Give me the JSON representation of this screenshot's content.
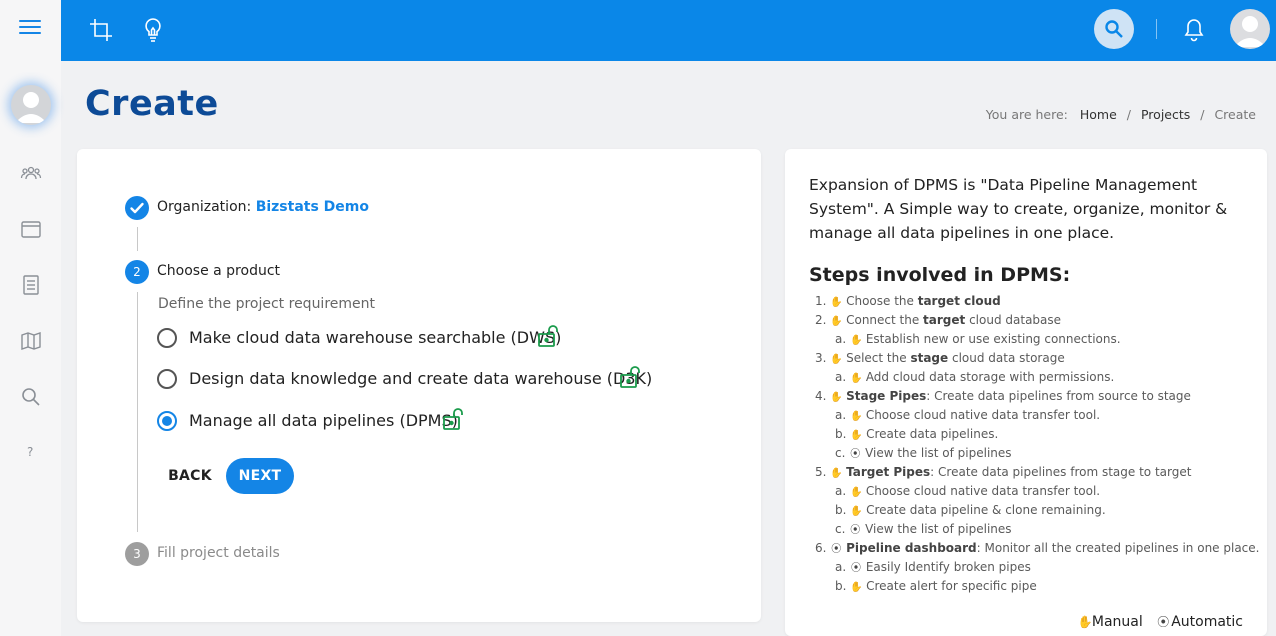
{
  "rail": {
    "items": [
      "groups-icon",
      "window-icon",
      "document-icon",
      "map-icon",
      "search-icon"
    ],
    "help_label": "?"
  },
  "header": {
    "title": "Create",
    "breadcrumb": {
      "prefix": "You are here:",
      "items": [
        "Home",
        "Projects"
      ],
      "current": "Create"
    }
  },
  "stepper": {
    "step1": {
      "label": "Organization:",
      "value": "Bizstats Demo"
    },
    "step2": {
      "number": "2",
      "label": "Choose a product",
      "sublabel": "Define the project requirement",
      "options": [
        {
          "label": "Make cloud data warehouse searchable (DWS)",
          "selected": false
        },
        {
          "label": "Design data knowledge and create data warehouse (D3K)",
          "selected": false
        },
        {
          "label": "Manage all data pipelines (DPMS)",
          "selected": true
        }
      ],
      "back_label": "BACK",
      "next_label": "NEXT"
    },
    "step3": {
      "number": "3",
      "label": "Fill project details"
    }
  },
  "info": {
    "intro": "Expansion of DPMS is \"Data Pipeline Management System\". A Simple way to create, organize, monitor & manage all data pipelines in one place.",
    "heading": "Steps involved in DPMS:",
    "steps": [
      {
        "marker": "1.",
        "icon": "manual",
        "parts": [
          [
            "Choose the ",
            false
          ],
          [
            "target cloud",
            true
          ]
        ],
        "sub": []
      },
      {
        "marker": "2.",
        "icon": "manual",
        "parts": [
          [
            "Connect the ",
            false
          ],
          [
            "target",
            true
          ],
          [
            " cloud database",
            false
          ]
        ],
        "sub": [
          {
            "marker": "a.",
            "icon": "manual",
            "text": "Establish new or use existing connections."
          }
        ]
      },
      {
        "marker": "3.",
        "icon": "manual",
        "parts": [
          [
            "Select the ",
            false
          ],
          [
            "stage",
            true
          ],
          [
            " cloud data storage",
            false
          ]
        ],
        "sub": [
          {
            "marker": "a.",
            "icon": "manual",
            "text": "Add cloud data storage with permissions."
          }
        ]
      },
      {
        "marker": "4.",
        "icon": "manual",
        "parts": [
          [
            "Stage Pipes",
            true
          ],
          [
            ": Create data pipelines from source to stage",
            false
          ]
        ],
        "sub": [
          {
            "marker": "a.",
            "icon": "manual",
            "text": "Choose cloud native data transfer tool."
          },
          {
            "marker": "b.",
            "icon": "manual",
            "text": "Create data pipelines."
          },
          {
            "marker": "c.",
            "icon": "automatic",
            "text": "View the list of pipelines"
          }
        ]
      },
      {
        "marker": "5.",
        "icon": "manual",
        "parts": [
          [
            "Target Pipes",
            true
          ],
          [
            ": Create data pipelines from stage to target",
            false
          ]
        ],
        "sub": [
          {
            "marker": "a.",
            "icon": "manual",
            "text": "Choose cloud native data transfer tool."
          },
          {
            "marker": "b.",
            "icon": "manual",
            "text": "Create data pipeline & clone remaining."
          },
          {
            "marker": "c.",
            "icon": "automatic",
            "text": "View the list of pipelines"
          }
        ]
      },
      {
        "marker": "6.",
        "icon": "automatic",
        "parts": [
          [
            "Pipeline dashboard",
            true
          ],
          [
            ": Monitor all the created pipelines in one place.",
            false
          ]
        ],
        "sub": [
          {
            "marker": "a.",
            "icon": "automatic",
            "text": "Easily Identify broken pipes"
          },
          {
            "marker": "b.",
            "icon": "manual",
            "text": "Create alert for specific pipe"
          }
        ]
      }
    ],
    "legend": {
      "manual": "Manual",
      "automatic": "Automatic"
    },
    "glyphs": {
      "manual": "✋",
      "automatic": "⦿"
    }
  },
  "colors": {
    "primary": "#0a87e8",
    "accent": "#1485e6",
    "title": "#0d4b97",
    "unlock": "#1a9b4b"
  }
}
